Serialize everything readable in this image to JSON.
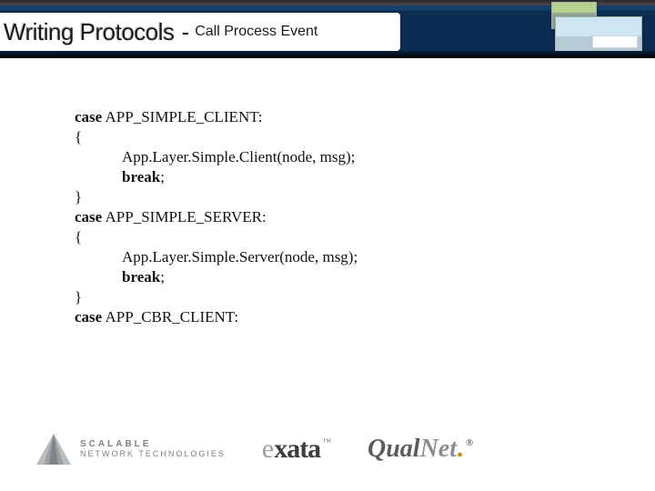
{
  "header": {
    "title_main": "Writing Protocols",
    "separator": "-",
    "title_sub": "Call Process Event"
  },
  "code": {
    "l1_kw": "case",
    "l1_rest": " APP_SIMPLE_CLIENT:",
    "l2": "{",
    "l3": "App.Layer.Simple.Client(node, msg);",
    "l4_kw": "break",
    "l4_rest": ";",
    "l5": "}",
    "l6_kw": "case",
    "l6_rest": " APP_SIMPLE_SERVER:",
    "l7": "{",
    "l8": "App.Layer.Simple.Server(node, msg);",
    "l9_kw": "break",
    "l9_rest": ";",
    "l10": "}",
    "l11_kw": "case",
    "l11_rest": " APP_CBR_CLIENT:"
  },
  "footer": {
    "scalable_row1": "SCALABLE",
    "scalable_row2": "NETWORK TECHNOLOGIES",
    "exata_e": "e",
    "exata_rest": "xata",
    "exata_tm": "™",
    "qualnet_a": "Qual",
    "qualnet_b": "Net",
    "qualnet_dot": ".",
    "qualnet_reg": "®"
  }
}
